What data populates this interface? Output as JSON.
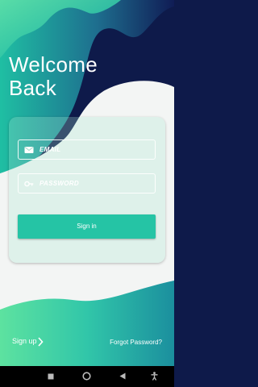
{
  "welcome": {
    "title_line1": "Welcome",
    "title_line2": "Back"
  },
  "form": {
    "email_placeholder": "EMAIL",
    "password_placeholder": "PASSWORD",
    "signin_label": "Sign in"
  },
  "footer": {
    "signup_label": "Sign up",
    "forgot_label": "Forgot Password?"
  },
  "icons": {
    "email": "mail-icon",
    "password": "key-icon",
    "signup_arrow": "chevron-right-icon",
    "nav_back": "back-triangle-icon",
    "nav_home": "home-circle-icon",
    "nav_recents": "recents-square-icon",
    "nav_accessibility": "accessibility-icon"
  },
  "colors": {
    "navy": "#0e1a4a",
    "teal": "#25c4a5",
    "light_bg": "#f3f5f4"
  }
}
